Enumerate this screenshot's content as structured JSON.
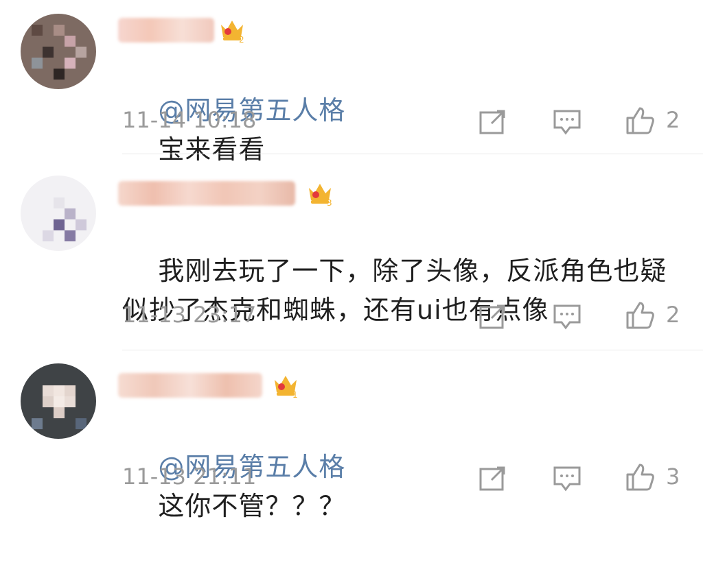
{
  "comments": [
    {
      "mention": "@网易第五人格",
      "text": "宝来看看",
      "timestamp": "11-14 10:18",
      "likes": "2",
      "crown_level": "2"
    },
    {
      "mention": "",
      "text": "我刚去玩了一下，除了头像，反派角色也疑\n似抄了杰克和蜘蛛，还有ui也有点像",
      "timestamp": "11-13 23:17",
      "likes": "2",
      "crown_level": "3"
    },
    {
      "mention": "@网易第五人格",
      "text": "这你不管？？？",
      "timestamp": "11-13 21:11",
      "likes": "3",
      "crown_level": "1"
    }
  ],
  "icons": {
    "share": "share-icon",
    "comment": "comment-icon",
    "like": "thumbs-up-icon",
    "crown": "vip-crown-icon"
  },
  "colors": {
    "mention": "#5a7ea8",
    "meta": "#9a9a9a",
    "crown_gold": "#f3b431",
    "crown_red": "#e3393c"
  }
}
